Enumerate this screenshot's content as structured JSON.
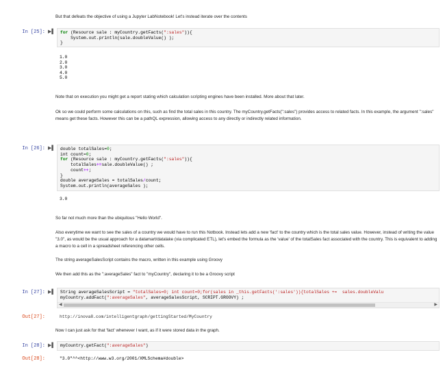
{
  "md1": "But that defeats the objective of using a Jupyter LabNotebook! Let's instead iterate over the contents",
  "cell25": {
    "prompt": "In [25]:",
    "code": [
      [
        [
          "kw",
          "for"
        ],
        [
          "",
          " (Resource sale : myCountry.getFacts("
        ],
        [
          "str",
          "\":sales\""
        ],
        [
          "",
          ")){"
        ]
      ],
      [
        [
          "",
          "    System.out.println(sale.doubleValue() );"
        ]
      ],
      [
        [
          "",
          "}"
        ]
      ]
    ],
    "output": [
      "1.0",
      "2.0",
      "3.0",
      "4.0",
      "5.0"
    ]
  },
  "md2": "Note that on execution you might get a report stating which calculation scripting engines have been installed. More about that later.",
  "md3": "Ok so we could perform some calculations on this, such as find the total sales in this country. The myCountry.getFacts(\":sales\") provides access to related facts. In this example, the argument \":sales\" means get these facts. However this can be a pathQL expression, allowing access to any directly or indirectly related information.",
  "cell26": {
    "prompt": "In [26]:",
    "code": [
      [
        [
          "",
          "double totalSales="
        ],
        [
          "num",
          "0"
        ],
        [
          "",
          ";"
        ]
      ],
      [
        [
          "",
          "int count="
        ],
        [
          "num",
          "0"
        ],
        [
          "",
          ";"
        ]
      ],
      [
        [
          "kw",
          "for"
        ],
        [
          "",
          " (Resource sale : myCountry.getFacts("
        ],
        [
          "str",
          "\":sales\""
        ],
        [
          "",
          ")){"
        ]
      ],
      [
        [
          "",
          "    totalSales"
        ],
        [
          "op",
          "+="
        ],
        [
          "",
          "sale.doubleValue() ;"
        ]
      ],
      [
        [
          "",
          "    count"
        ],
        [
          "op",
          "++"
        ],
        [
          "",
          ";"
        ]
      ],
      [
        [
          "",
          "}"
        ]
      ],
      [
        [
          "",
          "double averageSales = totalSales"
        ],
        [
          "op",
          "/"
        ],
        [
          "",
          "count;"
        ]
      ],
      [
        [
          "",
          "System.out.println(averageSales );"
        ]
      ]
    ],
    "output": [
      "3.0"
    ]
  },
  "md4": "So far not much more than the ubiquitous \"Hello World\".",
  "md5": "Also everytime we want to see the sales of a country we would have to run this Notbook. Instead lets add a new 'fact' to the country which is the total sales value. However, instead of writing the value \"3.0\", as would be the usual approach for a datamart/datalake (via complicated ETL), let's embed the formula as the 'value' of the totalSales fact associated with the country. This is equivalent to adding a macro to a cell in a spreadsheet referencing other cells.",
  "md6": "The string averageSalesScript contains the macro, written in this example using Groovy",
  "md7": "We then add this as the \":averageSales\" fact to \"myCountry\", declaring it to be a Groovy script",
  "cell27": {
    "prompt": "In [27]:",
    "out_prompt": "Out[27]:",
    "code": [
      [
        [
          "",
          "String averageSalesScript = "
        ],
        [
          "str",
          "\"totalSales=0; int count=0;for(sales in _this.getFacts(':sales')){totalSales +=  sales.doubleValu"
        ]
      ],
      [
        [
          "",
          "myCountry.addFact("
        ],
        [
          "str",
          "\":averageSales\""
        ],
        [
          "",
          ", averageSalesScript, SCRIPT.GROOVY) ;"
        ]
      ]
    ],
    "output": "http://inova8.com/intelligentgraph/gettingStarted/MyCountry"
  },
  "md8": "Now I can just ask for that 'fact' whenever I want, as if it were stored data in the graph.",
  "cell28": {
    "prompt": "In [28]:",
    "out_prompt": "Out[28]:",
    "code": [
      [
        [
          "",
          "myCountry.getFact("
        ],
        [
          "str",
          "\":averageSales\""
        ],
        [
          "",
          ")"
        ]
      ]
    ],
    "output": "\"3.0\"^^<http://www.w3.org/2001/XMLSchema#double>"
  },
  "icons": {
    "run": "run-indicator-icon",
    "left": "arrow-left-icon",
    "right": "arrow-right-icon"
  }
}
